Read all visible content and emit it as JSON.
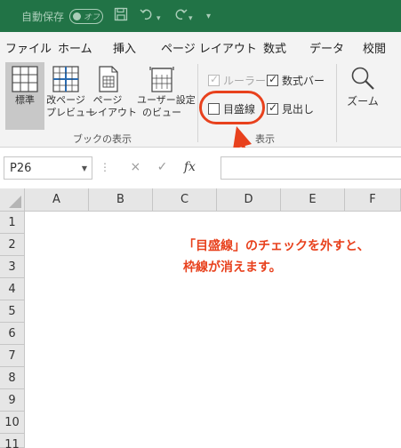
{
  "titlebar": {
    "autosave_label": "自動保存",
    "toggle_state": "オフ",
    "save_icon": "save-icon",
    "undo_icon": "undo-icon",
    "redo_icon": "redo-icon",
    "customize_icon": "customize-qat-icon"
  },
  "tabs": [
    "ファイル",
    "ホーム",
    "挿入",
    "ページ レイアウト",
    "数式",
    "データ",
    "校閲"
  ],
  "ribbon": {
    "view_buttons": [
      {
        "label1": "標準",
        "label2": "",
        "icon": "normal-view-icon",
        "selected": true
      },
      {
        "label1": "改ページ",
        "label2": "プレビュー",
        "icon": "page-break-preview-icon",
        "selected": false
      },
      {
        "label1": "ページ",
        "label2": "レイアウト",
        "icon": "page-layout-icon",
        "selected": false
      },
      {
        "label1": "ユーザー設定",
        "label2": "のビュー",
        "icon": "custom-views-icon",
        "selected": false
      }
    ],
    "workbook_views_label": "ブックの表示",
    "show_group_label": "表示",
    "checkboxes": {
      "ruler": {
        "label": "ルーラー",
        "checked": true,
        "disabled": true
      },
      "gridlines": {
        "label": "目盛線",
        "checked": false,
        "disabled": false
      },
      "formula_bar": {
        "label": "数式バー",
        "checked": true,
        "disabled": false
      },
      "headings": {
        "label": "見出し",
        "checked": true,
        "disabled": false
      }
    },
    "zoom_label": "ズーム",
    "zoom_icon": "magnifier-icon"
  },
  "formula_bar": {
    "namebox_value": "P26",
    "cancel_icon": "×",
    "enter_icon": "✓",
    "fx_label": "fx",
    "formula_value": ""
  },
  "grid": {
    "columns": [
      "A",
      "B",
      "C",
      "D",
      "E",
      "F"
    ],
    "rows": [
      "1",
      "2",
      "3",
      "4",
      "5",
      "6",
      "7",
      "8",
      "9",
      "10",
      "11"
    ]
  },
  "annotation": {
    "line1": "「目盛線」のチェックを外すと、",
    "line2": "枠線が消えます。",
    "color": "#e8411d"
  },
  "colors": {
    "excel_green": "#217346",
    "ribbon_bg": "#f3f3f3",
    "accent_red": "#e8411d"
  }
}
